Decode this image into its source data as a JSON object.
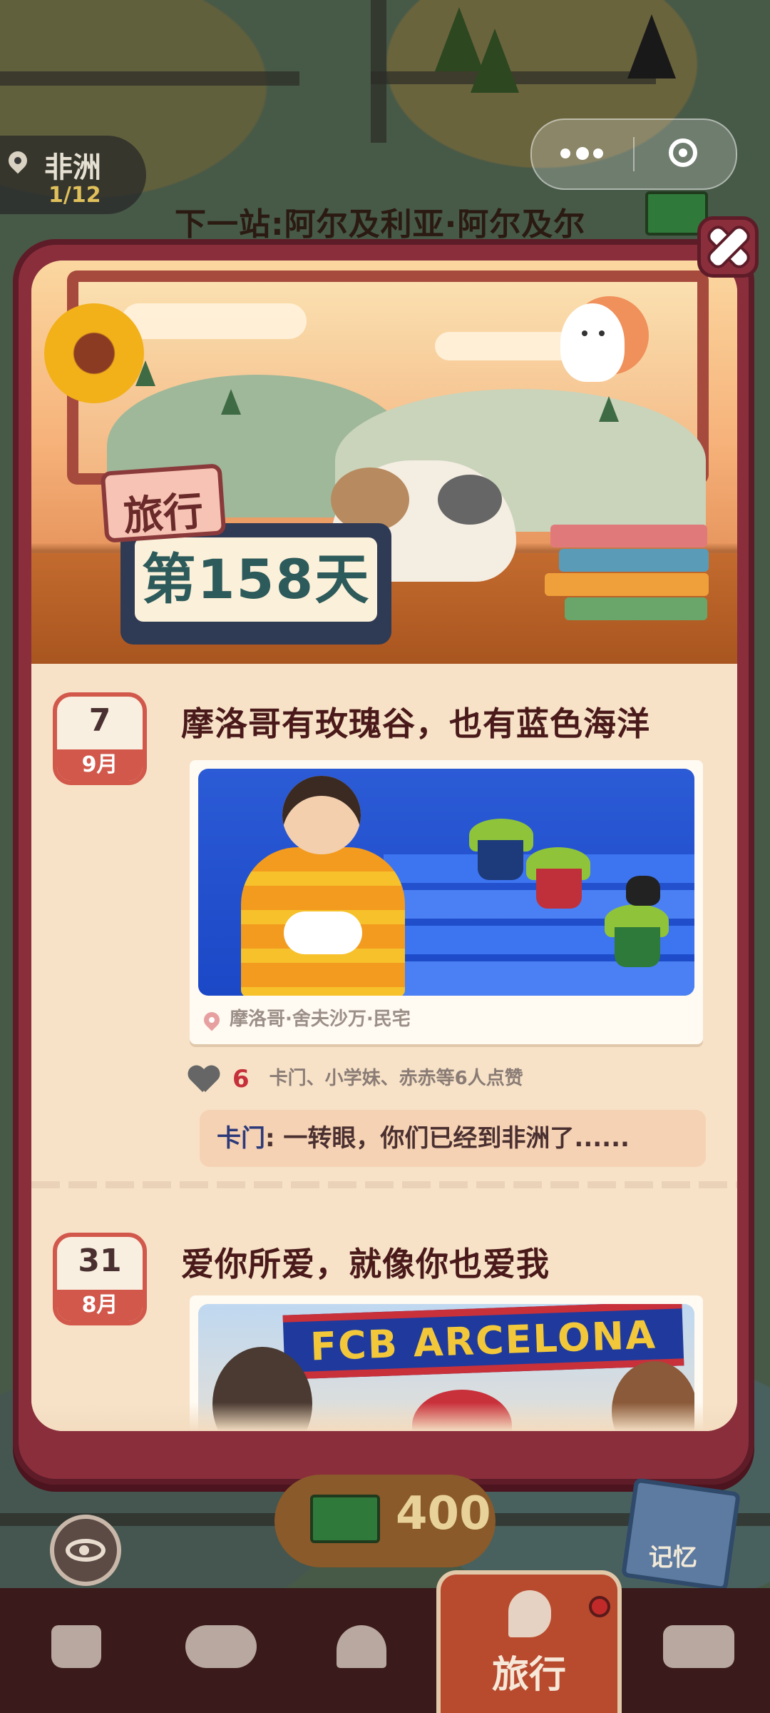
{
  "location": {
    "region": "非洲",
    "progress": "1/12",
    "next_stop": "下一站:阿尔及利亚·阿尔及尔"
  },
  "modal": {
    "travel_tag": "旅行",
    "day_counter": "第158天"
  },
  "posts": [
    {
      "day": "7",
      "month": "9月",
      "title": "摩洛哥有玫瑰谷，也有蓝色海洋",
      "location": "摩洛哥·舍夫沙万·民宅",
      "like_count": "6",
      "like_text": "卡门、小学妹、赤赤等6人点赞",
      "comment_author": "卡门",
      "comment_text": ": 一转眼，你们已经到非洲了......"
    },
    {
      "day": "31",
      "month": "8月",
      "title": "爱你所爱，就像你也爱我",
      "photo_banner": "FCB ARCELONA"
    }
  ],
  "bottom": {
    "coins": "400",
    "memory_label": "记忆",
    "active_tab": "旅行"
  },
  "colors": {
    "frame": "#8a2e3c",
    "panel": "#f3dcc0",
    "accent_red": "#d1584b",
    "like_red": "#c6303a"
  },
  "icons": [
    "location-pin-icon",
    "more-dots-icon",
    "target-icon",
    "close-icon",
    "heart-icon",
    "eye-icon",
    "bag-icon",
    "hands-icon",
    "bell-icon",
    "travel-icon",
    "bus-icon"
  ]
}
